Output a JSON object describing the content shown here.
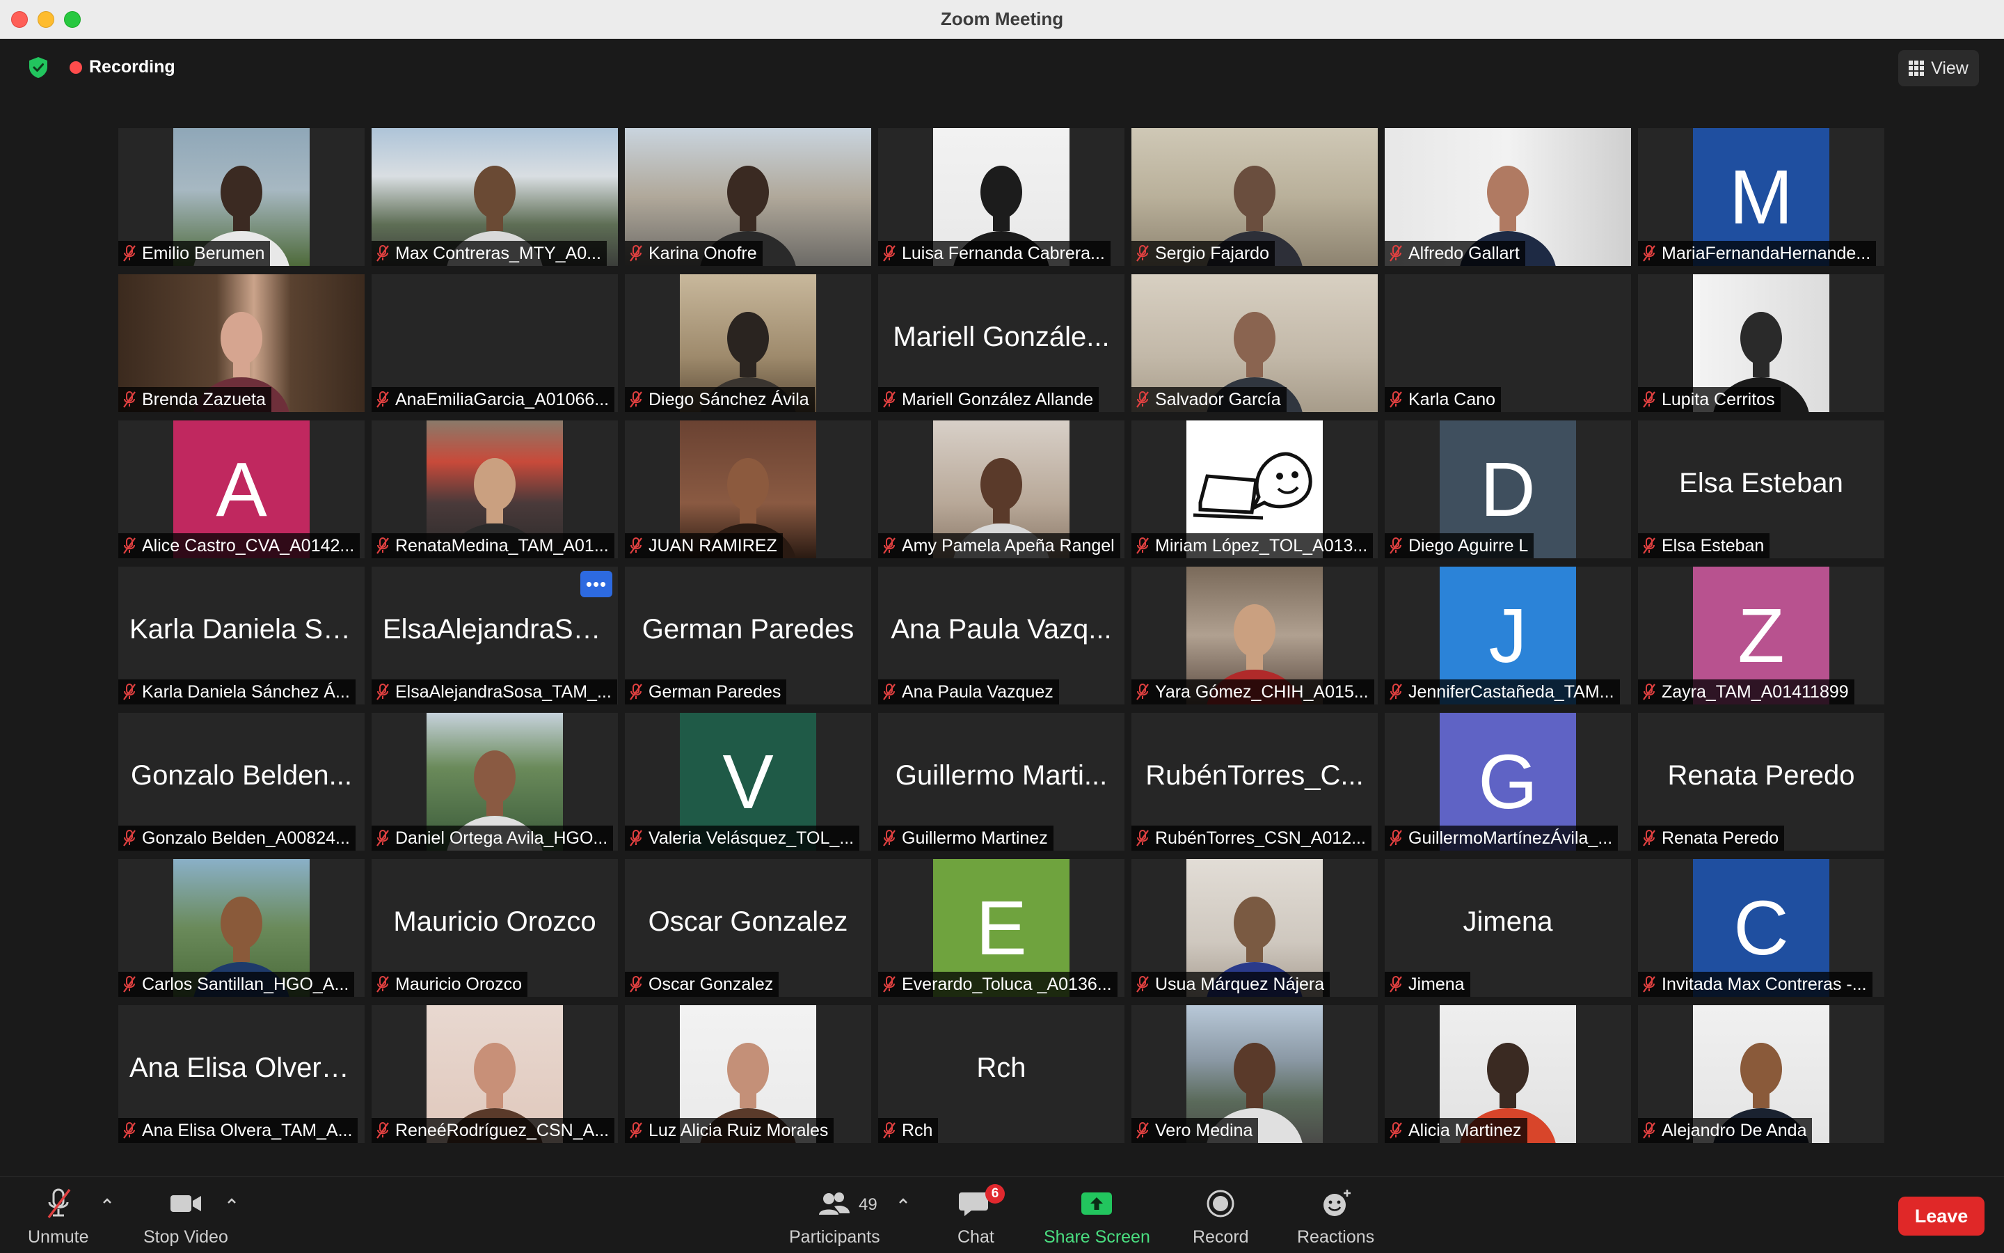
{
  "window": {
    "title": "Zoom Meeting"
  },
  "recording_label": "Recording",
  "view_label": "View",
  "colors": {
    "accent_green": "#22c55e",
    "recording_red": "#ff4c4c",
    "leave_red": "#e02828",
    "active_speaker": "#e2e07a"
  },
  "tiles": [
    {
      "name": "Emilio Berumen",
      "kind": "video",
      "bg": "linear-gradient(180deg,#8fa7b8 0%,#a7b8c2 45%,#4e6a3a 100%)",
      "fg": "#3b2a22",
      "fg2": "#e8e8e8"
    },
    {
      "name": "Max Contreras_MTY_A0...",
      "kind": "video",
      "wide": true,
      "bg": "linear-gradient(180deg,#aec4d8 0%,#d9dee2 35%,#5e6e55 70%,#3b3d3a 100%)",
      "fg": "#6a4a34",
      "fg2": "#d9d9d9"
    },
    {
      "name": "Karina Onofre",
      "kind": "video",
      "wide": true,
      "bg": "linear-gradient(180deg,#c9d4de 0%,#b0a89a 50%,#6c6a66 100%)",
      "fg": "#3a2a22",
      "fg2": "#2a2a2a"
    },
    {
      "name": "Luisa Fernanda Cabrera...",
      "kind": "video",
      "bg": "linear-gradient(180deg,#f2f2f2 0%,#e8e8e8 100%)",
      "fg": "#1c1c1c",
      "fg2": "#1a1a1a"
    },
    {
      "name": "Sergio Fajardo",
      "kind": "video",
      "active": true,
      "wide": true,
      "bg": "linear-gradient(180deg,#cfc8b6 0%,#b9b09a 50%,#8d8370 100%)",
      "fg": "#6a4e3e",
      "fg2": "#2d2f38"
    },
    {
      "name": "Alfredo Gallart",
      "kind": "video",
      "wide": true,
      "bg": "linear-gradient(90deg,#e7e7e7 0%,#f2f2f2 50%,#cfcfcf 100%)",
      "fg": "#b07a62",
      "fg2": "#1e2a44"
    },
    {
      "name": "MariaFernandaHernande...",
      "kind": "avatar",
      "letter": "M",
      "color": "#1f4fa0"
    },
    {
      "name": "Brenda Zazueta",
      "kind": "video",
      "wide": true,
      "bg": "linear-gradient(90deg,#3b2a1e 0%,#5a4230 40%,#caa38a 55%,#5a4230 70%,#3b2a1e 100%)",
      "fg": "#d6a590",
      "fg2": "#6e2f3a"
    },
    {
      "name": "AnaEmiliaGarcia_A01066...",
      "kind": "blank"
    },
    {
      "name": "Diego Sánchez Ávila",
      "kind": "video",
      "bg": "linear-gradient(180deg,#c8b89c 0%,#9e8a6c 60%,#5a4a36 100%)",
      "fg": "#2a2420",
      "fg2": "#3a3530"
    },
    {
      "name": "Mariell Gonzále...",
      "full": "Mariell González Allande",
      "kind": "text"
    },
    {
      "name": "Salvador García",
      "kind": "video",
      "wide": true,
      "bg": "linear-gradient(180deg,#d8d0c2 0%,#c2b8a8 60%,#a79c8a 100%)",
      "fg": "#8a6450",
      "fg2": "#30363f"
    },
    {
      "name": "Karla Cano",
      "kind": "blank"
    },
    {
      "name": "Lupita Cerritos",
      "kind": "video",
      "bg": "linear-gradient(90deg,#f4f4f4 0%,#dcdcdc 100%)",
      "fg": "#2a2a2a",
      "fg2": "#1a1a1a"
    },
    {
      "name": "Alice Castro_CVA_A0142...",
      "kind": "avatar",
      "letter": "A",
      "color": "#c0285f"
    },
    {
      "name": "RenataMedina_TAM_A01...",
      "kind": "video",
      "bg": "linear-gradient(180deg,#8a7a6a 0%,#c84a3a 30%,#4a3a3a 60%,#2a2a2a 100%)",
      "fg": "#caa080",
      "fg2": "#2a2a2a"
    },
    {
      "name": "JUAN RAMIREZ",
      "kind": "video",
      "bg": "linear-gradient(180deg,#6a4232 0%,#8a5a42 60%,#2a1a12 100%)",
      "fg": "#8c5a3e",
      "fg2": "#2a1a12"
    },
    {
      "name": "Amy Pamela Apeña Rangel",
      "kind": "video",
      "bg": "linear-gradient(180deg,#d8d0c8 0%,#b8a898 60%,#8a7868 100%)",
      "fg": "#5a3a2a",
      "fg2": "#d8d8d8"
    },
    {
      "name": "Miriam López_TOL_A013...",
      "kind": "drawing"
    },
    {
      "name": "Diego Aguirre L",
      "kind": "avatar",
      "letter": "D",
      "color": "#3f4f5e"
    },
    {
      "name": "Elsa Esteban",
      "kind": "text"
    },
    {
      "name": "Karla Daniela Sá...",
      "full": "Karla Daniela Sánchez Á...",
      "kind": "text"
    },
    {
      "name": "ElsaAlejandraSo...",
      "full": "ElsaAlejandraSosa_TAM_...",
      "kind": "text",
      "more": true
    },
    {
      "name": "German Paredes",
      "kind": "text"
    },
    {
      "name": "Ana Paula Vazq...",
      "full": "Ana Paula Vazquez",
      "kind": "text"
    },
    {
      "name": "Yara Gómez_CHIH_A015...",
      "kind": "video",
      "bg": "linear-gradient(180deg,#7a6a5a 0%,#b0a090 50%,#5a4a40 100%)",
      "fg": "#caa080",
      "fg2": "#b02a2a"
    },
    {
      "name": "JenniferCastañeda_TAM...",
      "kind": "avatar",
      "letter": "J",
      "color": "#2b83d8"
    },
    {
      "name": "Zayra_TAM_A01411899",
      "kind": "avatar",
      "letter": "Z",
      "color": "#b8528f"
    },
    {
      "name": "Gonzalo Belden...",
      "full": "Gonzalo Belden_A00824...",
      "kind": "text"
    },
    {
      "name": "Daniel Ortega Avila_HGO...",
      "kind": "video",
      "bg": "linear-gradient(180deg,#c6d2dc 0%,#6a8a5a 40%,#3a5a3a 100%)",
      "fg": "#8a5a42",
      "fg2": "#e0e0e0"
    },
    {
      "name": "Valeria Velásquez_TOL_...",
      "kind": "avatar",
      "letter": "V",
      "color": "#1f5a47"
    },
    {
      "name": "Guillermo Marti...",
      "full": "Guillermo Martinez",
      "kind": "text"
    },
    {
      "name": "RubénTorres_C...",
      "full": "RubénTorres_CSN_A012...",
      "kind": "text"
    },
    {
      "name": "GuillermoMartínezÁvila_...",
      "kind": "avatar",
      "letter": "G",
      "color": "#5f63c5"
    },
    {
      "name": "Renata Peredo",
      "kind": "text"
    },
    {
      "name": "Carlos Santillan_HGO_A...",
      "kind": "video",
      "bg": "linear-gradient(180deg,#8ab0c8 0%,#6a8a5a 50%,#4a6a3a 100%)",
      "fg": "#8a5a3a",
      "fg2": "#1e3a6a"
    },
    {
      "name": "Mauricio Orozco",
      "kind": "text"
    },
    {
      "name": "Oscar Gonzalez",
      "kind": "text"
    },
    {
      "name": "Everardo_Toluca _A0136...",
      "kind": "avatar",
      "letter": "E",
      "color": "#6fa33e"
    },
    {
      "name": "Usua Márquez Nájera",
      "kind": "video",
      "bg": "linear-gradient(180deg,#e2ddd6 0%,#cfc8bf 60%,#a89e92 100%)",
      "fg": "#7a5a42",
      "fg2": "#2a3a8a"
    },
    {
      "name": "Jimena",
      "kind": "text"
    },
    {
      "name": "Invitada Max Contreras -...",
      "kind": "avatar",
      "letter": "C",
      "color": "#1f4fa0"
    },
    {
      "name": "Ana Elisa Olvera...",
      "full": "Ana Elisa Olvera_TAM_A...",
      "kind": "text"
    },
    {
      "name": "ReneéRodríguez_CSN_A...",
      "kind": "video",
      "bg": "linear-gradient(180deg,#e8d8d0 0%,#e0c8bc 100%)",
      "fg": "#c89078",
      "fg2": "#5a3a2a"
    },
    {
      "name": "Luz Alicia Ruiz Morales",
      "kind": "video",
      "bg": "linear-gradient(180deg,#f2f2f2 0%,#eaeaea 100%)",
      "fg": "#c49078",
      "fg2": "#5a3a2a"
    },
    {
      "name": "Rch",
      "kind": "text"
    },
    {
      "name": "Vero Medina",
      "kind": "video",
      "bg": "linear-gradient(180deg,#b8c8d8 0%,#8a98a4 40%,#5a6a5a 70%,#4a4a48 100%)",
      "fg": "#5a3a2a",
      "fg2": "#e0e0e0"
    },
    {
      "name": "Alicia Martinez",
      "kind": "video",
      "bg": "linear-gradient(180deg,#eeeeee 0%,#e2e2e2 100%)",
      "fg": "#3a2a22",
      "fg2": "#d8452a"
    },
    {
      "name": "Alejandro De Anda",
      "kind": "video",
      "bg": "linear-gradient(180deg,#f0f0f0 0%,#e4e4e4 100%)",
      "fg": "#8a5a3a",
      "fg2": "#1a2230"
    }
  ],
  "toolbar": {
    "unmute": "Unmute",
    "stop_video": "Stop Video",
    "participants": "Participants",
    "participant_count": "49",
    "chat": "Chat",
    "chat_badge": "6",
    "share_screen": "Share Screen",
    "record": "Record",
    "reactions": "Reactions",
    "leave": "Leave"
  }
}
